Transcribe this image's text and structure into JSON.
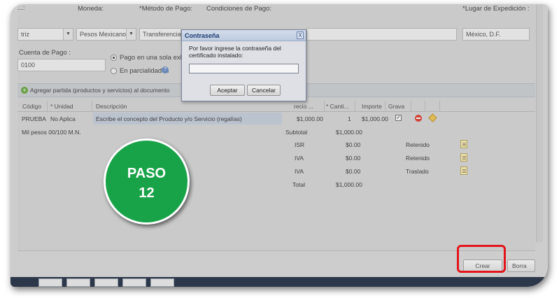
{
  "form": {
    "top_left_partial_label": "...:",
    "moneda_label": "Moneda:",
    "metodo_pago_label": "*Método de Pago:",
    "condiciones_label": "Condiciones de Pago:",
    "lugar_label": "*Lugar de Expedición :",
    "first_select_value": "triz",
    "moneda_value": "Pesos Mexicanos",
    "metodo_value": "Transferencia",
    "lugar_value": "México, D.F.",
    "cuenta_label": "Cuenta de Pago :",
    "cuenta_value": "0100",
    "radio_one_label": "Pago en una sola exhi",
    "radio_parc_label": "En parcialidades",
    "add_item_label": "Agregar partida (productos y servicios) al documento"
  },
  "table": {
    "headers": [
      "Código",
      "* Unidad",
      "Descripción",
      "recio ...",
      "* Canti...",
      "Importe",
      "Grava"
    ],
    "row": {
      "codigo": "PRUEBA",
      "unidad": "No Aplica",
      "descripcion": "Escribe el concepto del Producto y/o Servicio (regalías)",
      "precio": "$1,000.00",
      "cantidad": "1",
      "importe": "$1,000.00"
    },
    "amount_text": "Mil pesos 00/100 M.N.",
    "totals": [
      {
        "label": "Subtotal",
        "value": "$1,000.00",
        "type": ""
      },
      {
        "label": "ISR",
        "value": "$0.00",
        "type": "Retenido"
      },
      {
        "label": "IVA",
        "value": "$0.00",
        "type": "Retenido"
      },
      {
        "label": "IVA",
        "value": "$0.00",
        "type": "Traslado"
      },
      {
        "label": "Total",
        "value": "$1,000.00",
        "type": ""
      }
    ]
  },
  "footer": {
    "crear_label": "Crear",
    "borrar_label": "Borra"
  },
  "dialog": {
    "title": "Contraseña",
    "close": "X",
    "message": "Por favor ingrese la contraseña del certificado instalado:",
    "password_value": "",
    "accept_label": "Aceptar",
    "cancel_label": "Cancelar"
  },
  "annotation": {
    "step_word": "PASO",
    "step_number": "12",
    "badge_color": "#19a348",
    "highlight_color": "#e3151b"
  }
}
